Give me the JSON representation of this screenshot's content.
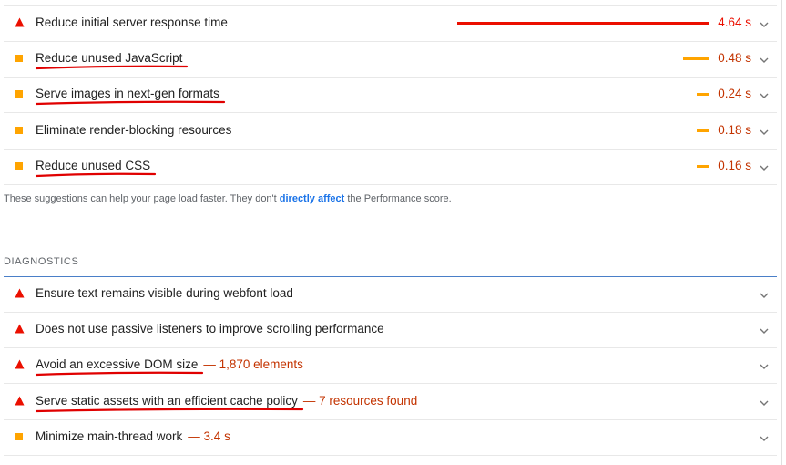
{
  "opportunities": [
    {
      "title": "Reduce initial server response time",
      "value": "4.64 s",
      "status": "fail",
      "bar_fraction": 1.0,
      "underlined": false
    },
    {
      "title": "Reduce unused JavaScript",
      "value": "0.48 s",
      "status": "average",
      "bar_fraction": 0.104,
      "underlined": true
    },
    {
      "title": "Serve images in next-gen formats",
      "value": "0.24 s",
      "status": "average",
      "bar_fraction": 0.052,
      "underlined": true
    },
    {
      "title": "Eliminate render-blocking resources",
      "value": "0.18 s",
      "status": "average",
      "bar_fraction": 0.039,
      "underlined": false
    },
    {
      "title": "Reduce unused CSS",
      "value": "0.16 s",
      "status": "average",
      "bar_fraction": 0.034,
      "underlined": true
    }
  ],
  "note": {
    "before": "These suggestions can help your page load faster. They don't ",
    "link": "directly affect",
    "after": " the Performance score."
  },
  "diagnostics_heading": "DIAGNOSTICS",
  "diagnostics": [
    {
      "title": "Ensure text remains visible during webfont load",
      "display": "",
      "status": "fail",
      "underlined": false
    },
    {
      "title": "Does not use passive listeners to improve scrolling performance",
      "display": "",
      "status": "fail",
      "underlined": false
    },
    {
      "title": "Avoid an excessive DOM size",
      "display": "— 1,870 elements",
      "status": "fail",
      "underlined": true
    },
    {
      "title": "Serve static assets with an efficient cache policy",
      "display": "— 7 resources found",
      "status": "fail",
      "underlined": true
    },
    {
      "title": "Minimize main-thread work",
      "display": "— 3.4 s",
      "status": "average",
      "underlined": false
    }
  ],
  "colors": {
    "fail": "#eb0f00",
    "average": "#ffa400",
    "link": "#1a73e8",
    "annotation": "#e00000"
  },
  "icons": {
    "fail": "red-triangle-icon",
    "average": "orange-square-icon",
    "expand": "chevron-down-icon"
  }
}
